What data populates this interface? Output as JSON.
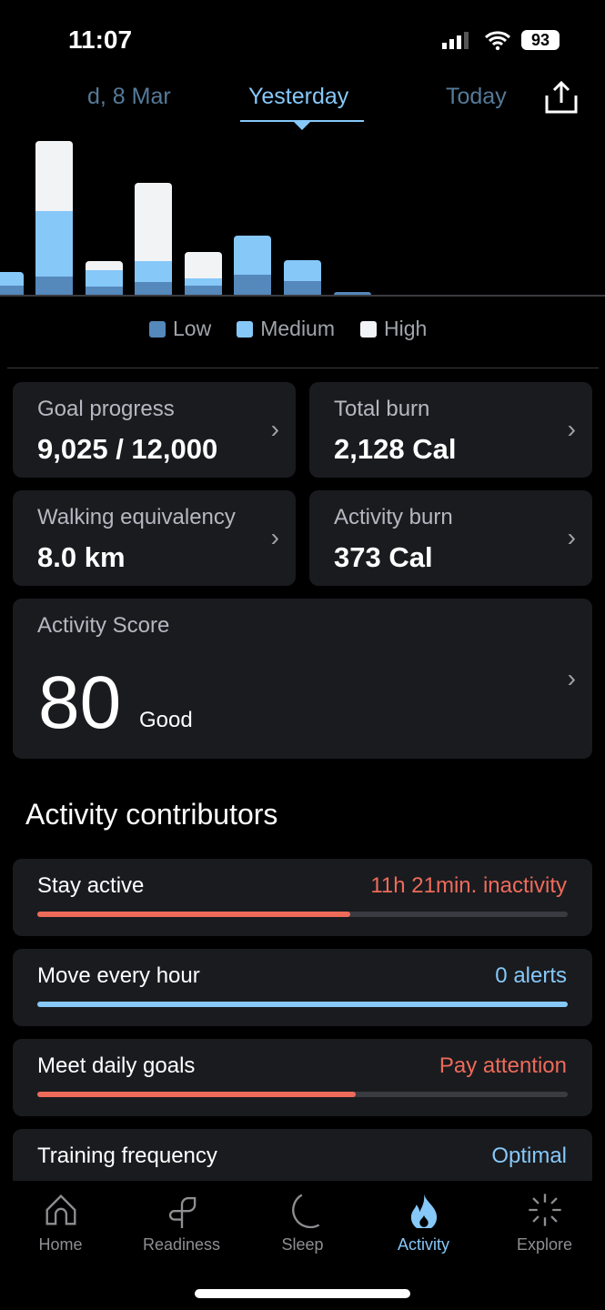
{
  "status": {
    "time": "11:07",
    "battery": "93"
  },
  "tabs": [
    {
      "label": "d, 8 Mar"
    },
    {
      "label": "Yesterday"
    },
    {
      "label": "Today"
    }
  ],
  "colors": {
    "low": "#5588bb",
    "medium": "#86c8f8",
    "high": "#f2f3f5",
    "accent": "#86c8f8",
    "warning": "#ee6b5a"
  },
  "chart_data": {
    "type": "bar",
    "stacked": true,
    "series": [
      {
        "name": "Low",
        "values": [
          10,
          20,
          9,
          14,
          10,
          22,
          15,
          3
        ]
      },
      {
        "name": "Medium",
        "values": [
          15,
          72,
          18,
          23,
          8,
          43,
          23,
          0
        ]
      },
      {
        "name": "High",
        "values": [
          0,
          77,
          10,
          86,
          29,
          0,
          0,
          0
        ]
      }
    ]
  },
  "legend": [
    "Low",
    "Medium",
    "High"
  ],
  "cards": [
    {
      "label": "Goal progress",
      "value": "9,025 / 12,000"
    },
    {
      "label": "Total burn",
      "value": "2,128 Cal"
    },
    {
      "label": "Walking equivalency",
      "value": "8.0 km"
    },
    {
      "label": "Activity burn",
      "value": "373 Cal"
    }
  ],
  "score": {
    "label": "Activity Score",
    "value": "80",
    "rating": "Good"
  },
  "contributors_title": "Activity contributors",
  "contributors": [
    {
      "name": "Stay active",
      "status": "11h 21min. inactivity",
      "progress": 0.59,
      "color": "#ee6b5a"
    },
    {
      "name": "Move every hour",
      "status": "0 alerts",
      "progress": 1.0,
      "color": "#86c8f8"
    },
    {
      "name": "Meet daily goals",
      "status": "Pay attention",
      "progress": 0.6,
      "color": "#ee6b5a"
    },
    {
      "name": "Training frequency",
      "status": "Optimal",
      "progress": 1.0,
      "color": "#86c8f8"
    }
  ],
  "nav": [
    {
      "label": "Home",
      "icon": "home-icon"
    },
    {
      "label": "Readiness",
      "icon": "sprout-icon"
    },
    {
      "label": "Sleep",
      "icon": "moon-icon"
    },
    {
      "label": "Activity",
      "icon": "flame-icon",
      "active": true
    },
    {
      "label": "Explore",
      "icon": "burst-icon"
    }
  ]
}
